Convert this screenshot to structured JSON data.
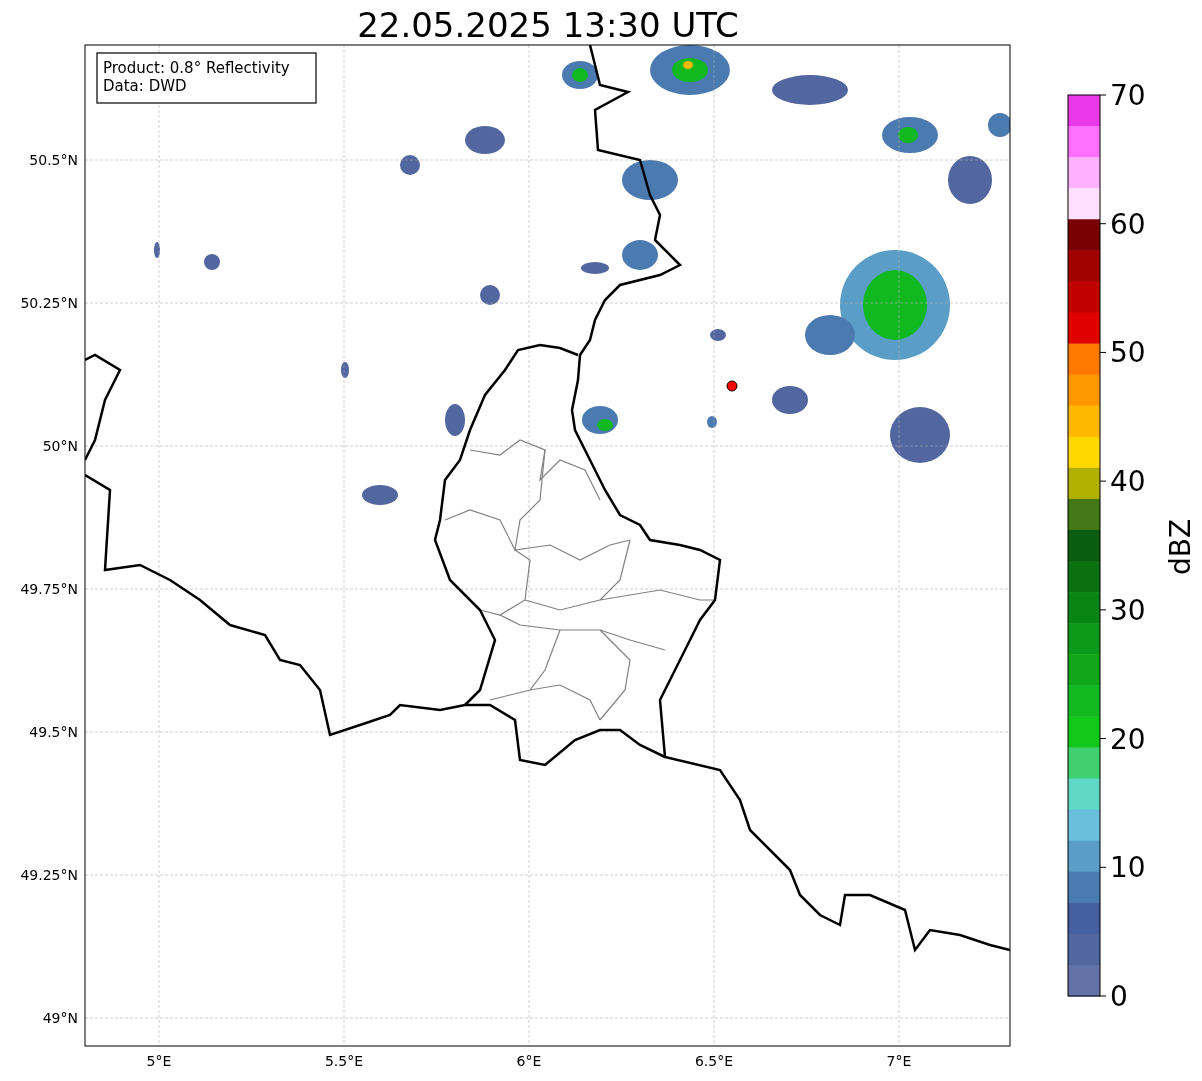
{
  "title": "22.05.2025 13:30 UTC",
  "info_box": [
    "Product: 0.8° Reflectivity",
    "Data: DWD"
  ],
  "lat_ticks": [
    "50.5°N",
    "50.25°N",
    "50°N",
    "49.75°N",
    "49.5°N",
    "49.25°N",
    "49°N"
  ],
  "lon_ticks": [
    "5°E",
    "5.5°E",
    "6°E",
    "6.5°E",
    "7°E"
  ],
  "colorbar": {
    "label": "dBZ",
    "ticks": [
      "70",
      "60",
      "50",
      "40",
      "30",
      "20",
      "10",
      "0"
    ],
    "bins": [
      {
        "color": "#e838e8"
      },
      {
        "color": "#ff70ff"
      },
      {
        "color": "#ffb0ff"
      },
      {
        "color": "#ffe0ff"
      },
      {
        "color": "#780000"
      },
      {
        "color": "#a00000"
      },
      {
        "color": "#c00000"
      },
      {
        "color": "#e00000"
      },
      {
        "color": "#ff7800"
      },
      {
        "color": "#ff9800"
      },
      {
        "color": "#ffb800"
      },
      {
        "color": "#ffd800"
      },
      {
        "color": "#b0b000"
      },
      {
        "color": "#447818"
      },
      {
        "color": "#0a5c10"
      },
      {
        "color": "#0a7010"
      },
      {
        "color": "#0a8414"
      },
      {
        "color": "#0c9818"
      },
      {
        "color": "#10a818"
      },
      {
        "color": "#12b820"
      },
      {
        "color": "#12c818"
      },
      {
        "color": "#40d070"
      },
      {
        "color": "#60d8c8"
      },
      {
        "color": "#68c0dc"
      },
      {
        "color": "#5a9ec8"
      },
      {
        "color": "#4a7ab0"
      },
      {
        "color": "#4460a0"
      },
      {
        "color": "#5266a0"
      },
      {
        "color": "#6373a8"
      }
    ]
  }
}
